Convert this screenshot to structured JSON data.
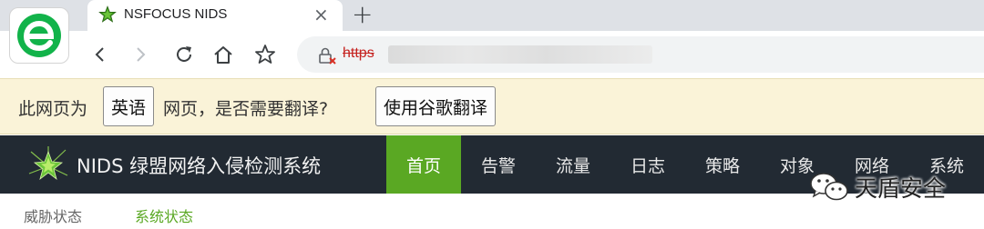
{
  "browser": {
    "app_logo_icon": "browser-e-logo",
    "tab": {
      "title": "NSFOCUS NIDS",
      "favicon": "green-star-icon",
      "close": "×"
    },
    "new_tab": "+",
    "toolbar": {
      "back": "back-icon",
      "forward": "forward-icon",
      "reload": "reload-icon",
      "home": "home-icon",
      "bookmark": "star-icon"
    },
    "omnibox": {
      "security_icon": "not-secure-lock-icon",
      "url_scheme": "https"
    }
  },
  "translate_bar": {
    "prefix": "此网页为",
    "language": "英语",
    "suffix": "网页，是否需要翻译?",
    "translate_button": "使用谷歌翻译"
  },
  "app": {
    "brand": {
      "logo_icon": "nsfocus-star-logo",
      "name": "NIDS 绿盟网络入侵检测系统"
    },
    "nav": [
      {
        "label": "首页",
        "active": true
      },
      {
        "label": "告警",
        "active": false
      },
      {
        "label": "流量",
        "active": false
      },
      {
        "label": "日志",
        "active": false
      },
      {
        "label": "策略",
        "active": false
      },
      {
        "label": "对象",
        "active": false
      },
      {
        "label": "网络",
        "active": false
      },
      {
        "label": "系统",
        "active": false
      }
    ],
    "subnav": [
      {
        "label": "威胁状态",
        "active": false
      },
      {
        "label": "系统状态",
        "active": true
      }
    ],
    "accent_color": "#5aa823",
    "nav_bg_color": "#222a33"
  },
  "watermark": {
    "text": "天盾安全",
    "icon": "wechat-icon"
  }
}
